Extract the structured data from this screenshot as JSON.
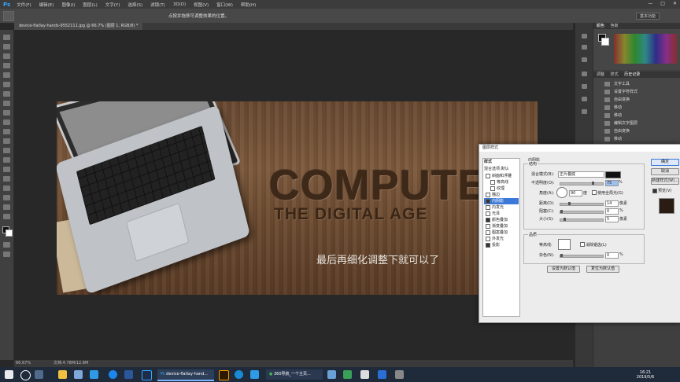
{
  "menubar": {
    "app_logo": "Ps",
    "items": [
      "文件(F)",
      "编辑(E)",
      "图像(I)",
      "图层(L)",
      "文字(Y)",
      "选择(S)",
      "滤镜(T)",
      "3D(D)",
      "视图(V)",
      "窗口(W)",
      "帮助(H)"
    ],
    "window_controls": [
      "—",
      "□",
      "✕"
    ]
  },
  "options_bar": {
    "hint": "点按并拖移可调整效果的位置。",
    "workspace": "基本功能"
  },
  "document_tab": {
    "label": "device-flatlay-hands-9552111.jpg @ 66.7% (图层 1, RGB/8) *"
  },
  "canvas": {
    "headline": "COMPUTE",
    "subheadline": "THE DIGITAL AGE",
    "caption": "最后再细化调整下就可以了"
  },
  "status_bar": {
    "zoom": "66.67%",
    "doc": "文档:4.78M/12.8M"
  },
  "panels": {
    "color_tabs": [
      "颜色",
      "色板"
    ],
    "history_tabs": [
      "调整",
      "样式",
      "历史记录"
    ],
    "history_items": [
      "文字工具",
      "设置字符样式",
      "自由变换",
      "移动",
      "移动",
      "编辑文字图层",
      "自由变换",
      "移动"
    ]
  },
  "dialog": {
    "title": "图层样式",
    "style_header": "样式",
    "blend_options": "混合选项:默认",
    "styles": [
      {
        "label": "斜面和浮雕",
        "checked": false,
        "indent": false,
        "selected": false
      },
      {
        "label": "等高线",
        "checked": false,
        "indent": true,
        "selected": false
      },
      {
        "label": "纹理",
        "checked": false,
        "indent": true,
        "selected": false
      },
      {
        "label": "描边",
        "checked": false,
        "indent": false,
        "selected": false
      },
      {
        "label": "内阴影",
        "checked": true,
        "indent": false,
        "selected": true
      },
      {
        "label": "内发光",
        "checked": false,
        "indent": false,
        "selected": false
      },
      {
        "label": "光泽",
        "checked": false,
        "indent": false,
        "selected": false
      },
      {
        "label": "颜色叠加",
        "checked": true,
        "indent": false,
        "selected": false
      },
      {
        "label": "渐变叠加",
        "checked": false,
        "indent": false,
        "selected": false
      },
      {
        "label": "图案叠加",
        "checked": false,
        "indent": false,
        "selected": false
      },
      {
        "label": "外发光",
        "checked": false,
        "indent": false,
        "selected": false
      },
      {
        "label": "投影",
        "checked": true,
        "indent": false,
        "selected": false
      }
    ],
    "section_title": "内阴影",
    "structure_title": "结构",
    "blend_mode_label": "混合模式(B):",
    "blend_mode_value": "正片叠底",
    "opacity_label": "不透明度(O):",
    "opacity_value": "75",
    "angle_label": "角度(A):",
    "angle_value": "90",
    "degree_unit": "度",
    "global_light_label": "使用全局光(G)",
    "distance_label": "距离(D):",
    "distance_value": "14",
    "choke_label": "阻塞(C):",
    "choke_value": "0",
    "size_label": "大小(S):",
    "size_value": "5",
    "pixel_unit": "像素",
    "percent_unit": "%",
    "quality_title": "品质",
    "contour_label": "等高线:",
    "antialias_label": "消除锯齿(L)",
    "noise_label": "杂色(N):",
    "noise_value": "0",
    "make_default": "设置为默认值",
    "reset_default": "复位为默认值",
    "ok": "确定",
    "cancel": "取消",
    "new_style": "新建样式(W)...",
    "preview": "预览(V)",
    "shadow_color": "#111111"
  },
  "taskbar": {
    "ps_window": "device-flatlay-hand...",
    "browser_window": "360导航_一个主页...",
    "time": "16:21",
    "date": "2019/5/6"
  }
}
